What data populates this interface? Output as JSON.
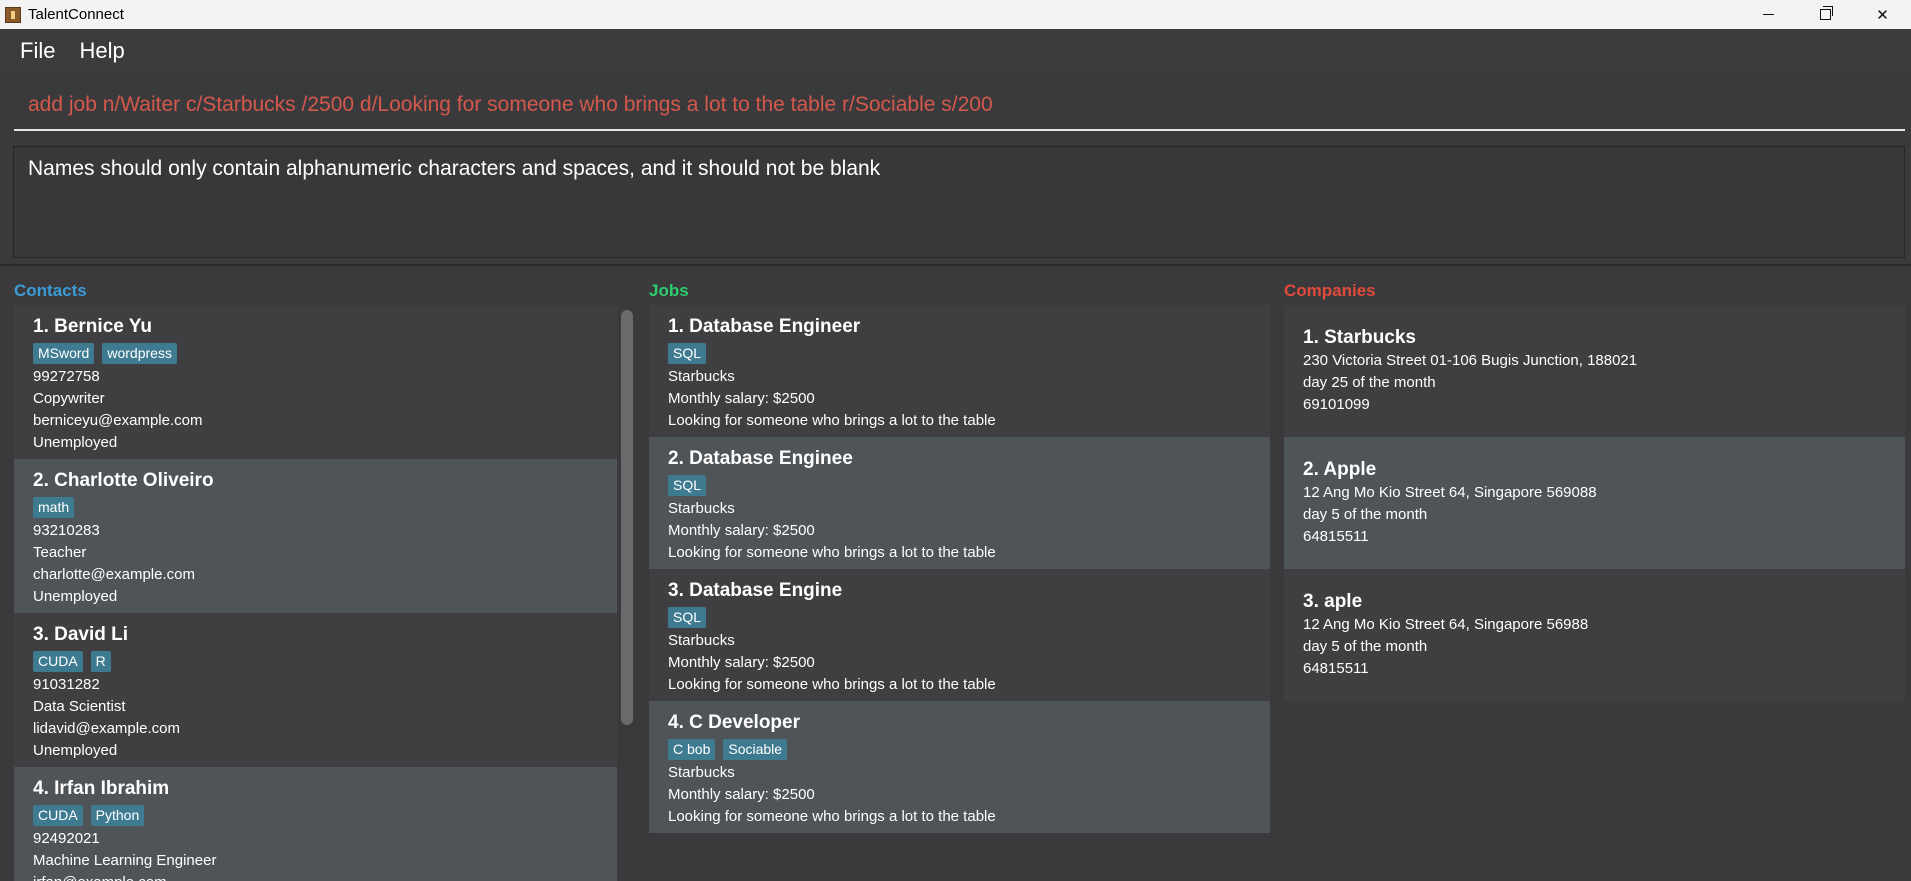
{
  "window": {
    "title": "TalentConnect"
  },
  "menu": {
    "file": "File",
    "help": "Help"
  },
  "command": {
    "value": "add job n/Waiter c/Starbucks /2500 d/Looking for someone who brings a lot to the table r/Sociable s/200"
  },
  "result": {
    "text": "Names should only contain alphanumeric characters and spaces, and it should not be blank"
  },
  "panels": {
    "contacts": "Contacts",
    "jobs": "Jobs",
    "companies": "Companies"
  },
  "contacts": [
    {
      "name": "1. Bernice Yu",
      "tags": [
        "MSword",
        "wordpress"
      ],
      "phone": "99272758",
      "role": "Copywriter",
      "email": "berniceyu@example.com",
      "status": "Unemployed"
    },
    {
      "name": "2. Charlotte Oliveiro",
      "tags": [
        "math"
      ],
      "phone": "93210283",
      "role": "Teacher",
      "email": "charlotte@example.com",
      "status": "Unemployed"
    },
    {
      "name": "3. David Li",
      "tags": [
        "CUDA",
        "R"
      ],
      "phone": "91031282",
      "role": "Data Scientist",
      "email": "lidavid@example.com",
      "status": "Unemployed"
    },
    {
      "name": "4. Irfan Ibrahim",
      "tags": [
        "CUDA",
        "Python"
      ],
      "phone": "92492021",
      "role": "Machine Learning Engineer",
      "email": "irfan@example.com",
      "status": ""
    }
  ],
  "jobs": [
    {
      "name": "1. Database Engineer",
      "tags": [
        "SQL"
      ],
      "company": "Starbucks",
      "salary": "Monthly salary: $2500",
      "desc": "Looking for someone who brings a lot to the table"
    },
    {
      "name": "2. Database Enginee",
      "tags": [
        "SQL"
      ],
      "company": "Starbucks",
      "salary": "Monthly salary: $2500",
      "desc": "Looking for someone who brings a lot to the table"
    },
    {
      "name": "3. Database Engine",
      "tags": [
        "SQL"
      ],
      "company": "Starbucks",
      "salary": "Monthly salary: $2500",
      "desc": "Looking for someone who brings a lot to the table"
    },
    {
      "name": "4. C Developer",
      "tags": [
        "C bob",
        "Sociable"
      ],
      "company": "Starbucks",
      "salary": "Monthly salary: $2500",
      "desc": "Looking for someone who brings a lot to the table"
    }
  ],
  "companies": [
    {
      "name": "1. Starbucks",
      "address": "230 Victoria Street 01-106 Bugis Junction, 188021",
      "billing": "day 25 of the month",
      "phone": "69101099"
    },
    {
      "name": "2. Apple",
      "address": "12 Ang Mo Kio Street 64, Singapore 569088",
      "billing": "day 5 of the month",
      "phone": "64815511"
    },
    {
      "name": "3. aple",
      "address": "12 Ang Mo Kio Street 64, Singapore 56988",
      "billing": "day 5 of the month",
      "phone": "64815511"
    }
  ]
}
